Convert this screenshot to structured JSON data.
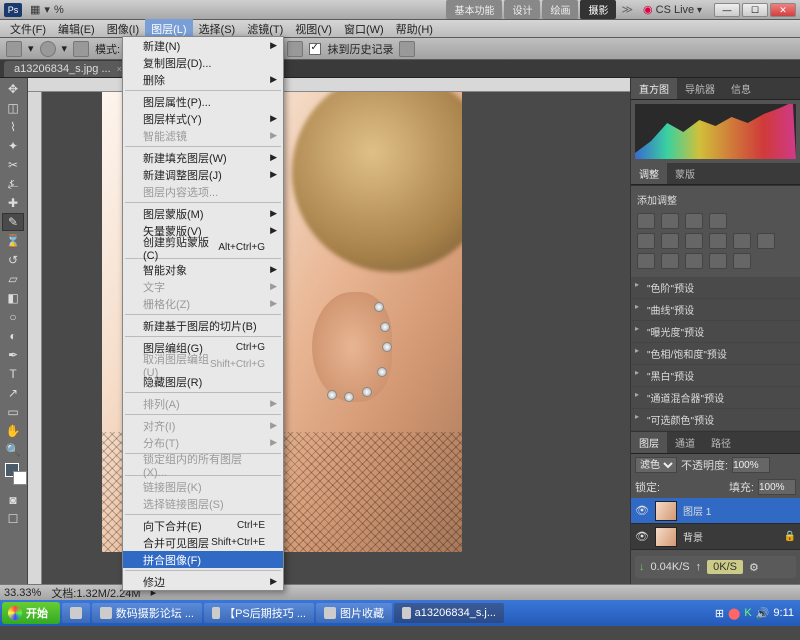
{
  "titlebar": {
    "logo": "Ps",
    "tabs": [
      "基本功能",
      "设计",
      "绘画",
      "摄影"
    ],
    "arrow": "≫",
    "cs": "CS Live"
  },
  "menubar": {
    "items": [
      "文件(F)",
      "编辑(E)",
      "图像(I)",
      "图层(L)",
      "选择(S)",
      "滤镜(T)",
      "视图(V)",
      "窗口(W)",
      "帮助(H)"
    ],
    "open_index": 3
  },
  "optbar": {
    "mode": "模式:",
    "flow": "≈",
    "pct": "%",
    "history": "抹到历史记录"
  },
  "doc_tab": {
    "name": "a13206834_s.jpg ...",
    "close": "×"
  },
  "dropdown": [
    {
      "t": "新建(N)",
      "a": true
    },
    {
      "t": "复制图层(D)...",
      "e": true
    },
    {
      "t": "删除",
      "a": true
    },
    {
      "sep": true
    },
    {
      "t": "图层属性(P)...",
      "e": true
    },
    {
      "t": "图层样式(Y)",
      "a": true
    },
    {
      "t": "智能滤镜",
      "d": true,
      "a": true
    },
    {
      "sep": true
    },
    {
      "t": "新建填充图层(W)",
      "a": true
    },
    {
      "t": "新建调整图层(J)",
      "a": true
    },
    {
      "t": "图层内容选项...",
      "d": true
    },
    {
      "sep": true
    },
    {
      "t": "图层蒙版(M)",
      "a": true
    },
    {
      "t": "矢量蒙版(V)",
      "a": true
    },
    {
      "t": "创建剪贴蒙版(C)",
      "sc": "Alt+Ctrl+G"
    },
    {
      "sep": true
    },
    {
      "t": "智能对象",
      "a": true
    },
    {
      "t": "文字",
      "d": true,
      "a": true
    },
    {
      "t": "栅格化(Z)",
      "d": true,
      "a": true
    },
    {
      "sep": true
    },
    {
      "t": "新建基于图层的切片(B)"
    },
    {
      "sep": true
    },
    {
      "t": "图层编组(G)",
      "sc": "Ctrl+G"
    },
    {
      "t": "取消图层编组(U)",
      "sc": "Shift+Ctrl+G",
      "d": true
    },
    {
      "t": "隐藏图层(R)"
    },
    {
      "sep": true
    },
    {
      "t": "排列(A)",
      "d": true,
      "a": true
    },
    {
      "sep": true
    },
    {
      "t": "对齐(I)",
      "d": true,
      "a": true
    },
    {
      "t": "分布(T)",
      "d": true,
      "a": true
    },
    {
      "sep": true
    },
    {
      "t": "锁定组内的所有图层(X)...",
      "d": true
    },
    {
      "sep": true
    },
    {
      "t": "链接图层(K)",
      "d": true
    },
    {
      "t": "选择链接图层(S)",
      "d": true
    },
    {
      "sep": true
    },
    {
      "t": "向下合并(E)",
      "sc": "Ctrl+E"
    },
    {
      "t": "合并可见图层",
      "sc": "Shift+Ctrl+E"
    },
    {
      "t": "拼合图像(F)",
      "hl": true
    },
    {
      "sep": true
    },
    {
      "t": "修边",
      "a": true
    }
  ],
  "panels": {
    "histogram_tabs": [
      "直方图",
      "导航器",
      "信息"
    ],
    "adjust_tabs": [
      "调整",
      "蒙版"
    ],
    "adjust_label": "添加调整",
    "presets": [
      "\"色阶\"预设",
      "\"曲线\"预设",
      "\"曝光度\"预设",
      "\"色相/饱和度\"预设",
      "\"黑白\"预设",
      "\"通道混合器\"预设",
      "\"可选颜色\"预设"
    ],
    "layer_tabs": [
      "图层",
      "通道",
      "路径"
    ],
    "blend": "滤色",
    "opacity_lbl": "不透明度:",
    "opacity": "100%",
    "lock_lbl": "锁定:",
    "fill_lbl": "填充:",
    "fill": "100%",
    "layers": [
      {
        "name": "图层 1",
        "sel": true
      },
      {
        "name": "背景"
      }
    ],
    "dl": {
      "down": "↓",
      "rate": "0.04K/S",
      "up": "↑",
      "ok": "0K/S"
    }
  },
  "status": {
    "zoom": "33.33%",
    "info": "文档:1.32M/2.24M"
  },
  "taskbar": {
    "start": "开始",
    "items": [
      "",
      "数码摄影论坛 ...",
      "【PS后期技巧 ...",
      "图片收藏",
      "a13206834_s.j..."
    ],
    "time": "9:11"
  }
}
